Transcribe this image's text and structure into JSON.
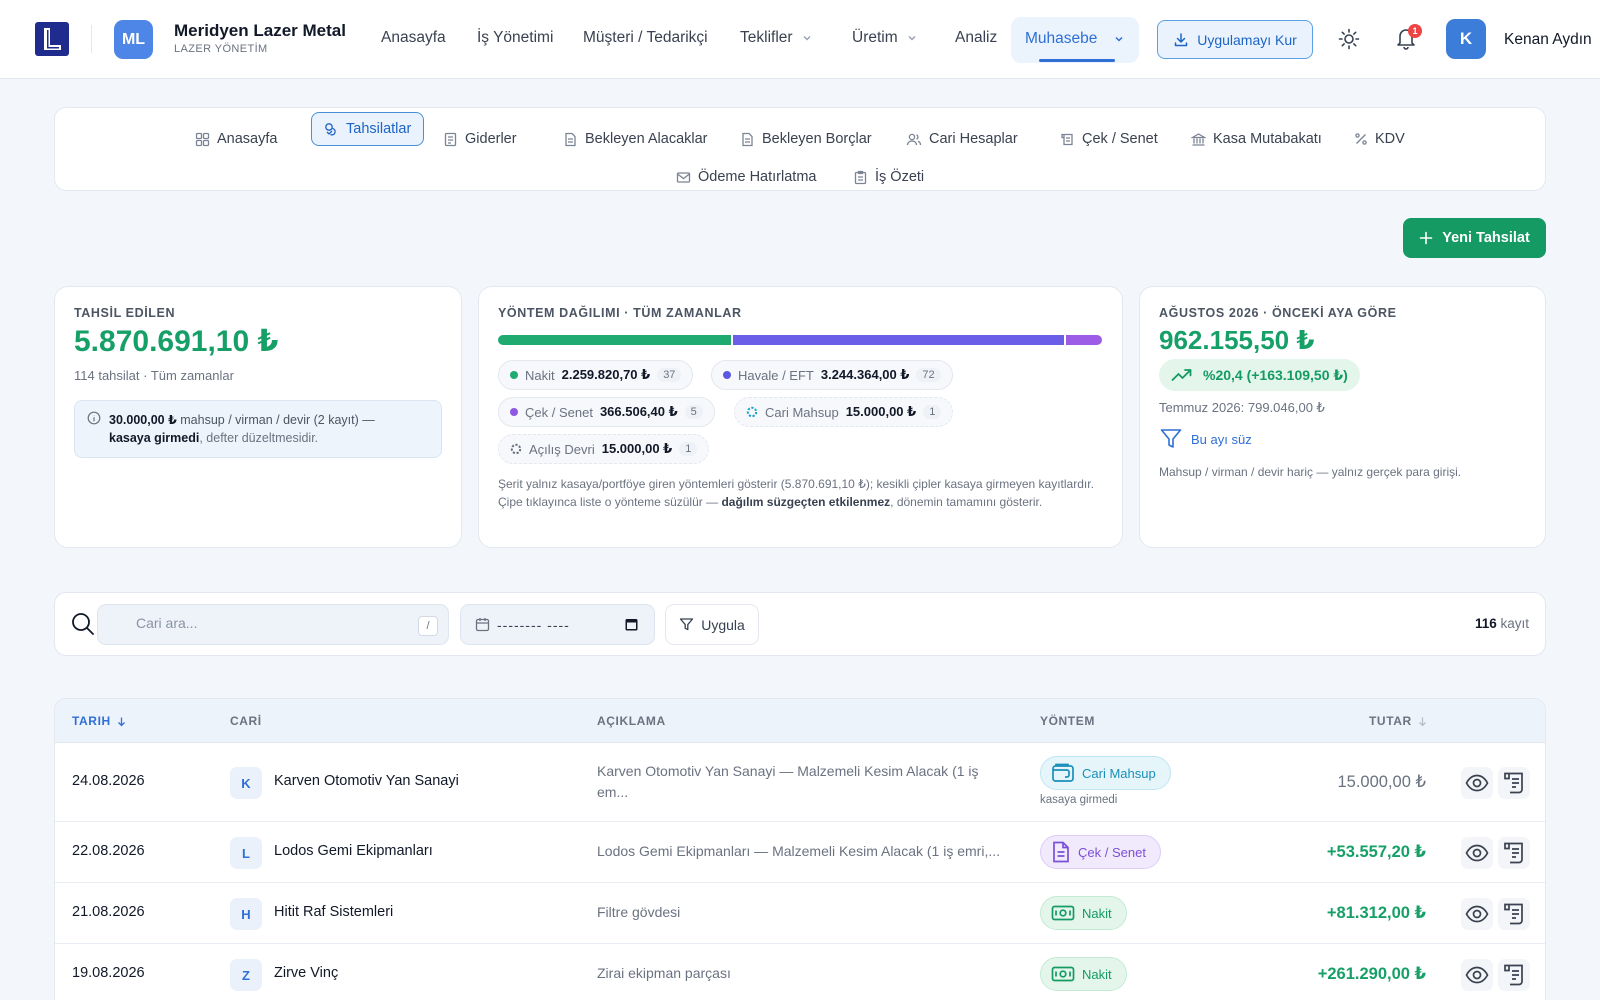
{
  "header": {
    "logo_letter": "L",
    "company": {
      "avatar": "ML",
      "name": "Meridyen Lazer Metal",
      "subtitle": "LAZER YÖNETİM"
    },
    "nav": [
      "Anasayfa",
      "İş Yönetimi",
      "Müşteri / Tedarikçi",
      "Teklifler",
      "Üretim",
      "Analiz",
      "Muhasebe"
    ],
    "active_nav": "Muhasebe",
    "install_label": "Uygulamayı Kur",
    "notification_count": "1",
    "user": {
      "avatar": "K",
      "name": "Kenan Aydın"
    }
  },
  "subnav": {
    "items": [
      "Anasayfa",
      "Tahsilatlar",
      "Giderler",
      "Bekleyen Alacaklar",
      "Bekleyen Borçlar",
      "Cari Hesaplar",
      "Çek / Senet",
      "Kasa Mutabakatı",
      "KDV",
      "Ödeme Hatırlatma",
      "İş Özeti"
    ],
    "active": "Tahsilatlar"
  },
  "new_button_label": "Yeni Tahsilat",
  "collected": {
    "label": "TAHSİL EDİLEN",
    "amount": "5.870.691,10 ₺",
    "sub": "114 tahsilat · Tüm zamanlar",
    "note_amount": "30.000,00 ₺",
    "note_text1": " mahsup / virman / devir (2 kayıt) —",
    "note_bold": "kasaya girmedi",
    "note_text2": ", defter düzeltmesidir."
  },
  "method_dist": {
    "label": "YÖNTEM DAĞILIMI · TÜM ZAMANLAR",
    "bar": [
      {
        "name": "Nakit",
        "fraction": 0.385,
        "color": "#1faa72"
      },
      {
        "name": "Havale / EFT",
        "fraction": 0.552,
        "color": "#6a5ee8"
      },
      {
        "name": "Çek / Senet",
        "fraction": 0.063,
        "color": "#9c5ce6"
      }
    ],
    "chips": [
      {
        "name": "Nakit",
        "value": "2.259.820,70 ₺",
        "count": "37",
        "color": "#1faa72"
      },
      {
        "name": "Havale / EFT",
        "value": "3.244.364,00 ₺",
        "count": "72",
        "color": "#5b57e0"
      },
      {
        "name": "Çek / Senet",
        "value": "366.506,40 ₺",
        "count": "5",
        "color": "#8e58e0"
      },
      {
        "name": "Cari Mahsup",
        "value": "15.000,00 ₺",
        "count": "1",
        "color": "#1aa3c8"
      },
      {
        "name": "Açılış Devri",
        "value": "15.000,00 ₺",
        "count": "1",
        "color": "#6b7280"
      }
    ],
    "foot_text1": "Şerit yalnız kasaya/portföye giren yöntemleri gösterir (5.870.691,10 ₺); kesikli çipler kasaya girmeyen kayıtlardır. Çipe tıklayınca liste o yönteme süzülür — ",
    "foot_bold": "dağılım süzgeçten etkilenmez",
    "foot_text2": ", dönemin tamamını gösterir."
  },
  "month_compare": {
    "label": "AĞUSTOS 2026 · ÖNCEKİ AYA GÖRE",
    "amount": "962.155,50 ₺",
    "change": "%20,4 (+163.109,50 ₺)",
    "prev": "Temmuz 2026: 799.046,00 ₺",
    "filter_label": "Bu ayı süz",
    "foot": "Mahsup / virman / devir hariç — yalnız gerçek para girişi."
  },
  "filters": {
    "search_placeholder": "Cari ara...",
    "shortcut": "/",
    "date_mask": "-------- ----",
    "apply_label": "Uygula",
    "count": "116",
    "count_suffix": " kayıt"
  },
  "table": {
    "headers": {
      "date": "TARIH",
      "cari": "CARİ",
      "desc": "AÇIKLAMA",
      "method": "YÖNTEM",
      "amount": "TUTAR"
    },
    "rows": [
      {
        "date": "24.08.2026",
        "initial": "K",
        "cari": "Karven Otomotiv Yan Sanayi",
        "desc": "Karven Otomotiv Yan Sanayi — Malzemeli Kesim Alacak (1 iş em...",
        "method": "Cari Mahsup",
        "method_note": "kasaya girmedi",
        "amount": "15.000,00 ₺"
      },
      {
        "date": "22.08.2026",
        "initial": "L",
        "cari": "Lodos Gemi Ekipmanları",
        "desc": "Lodos Gemi Ekipmanları — Malzemeli Kesim Alacak (1 iş emri,...",
        "method": "Çek / Senet",
        "method_note": "",
        "amount": "+53.557,20 ₺"
      },
      {
        "date": "21.08.2026",
        "initial": "H",
        "cari": "Hitit Raf Sistemleri",
        "desc": "Filtre gövdesi",
        "method": "Nakit",
        "method_note": "",
        "amount": "+81.312,00 ₺"
      },
      {
        "date": "19.08.2026",
        "initial": "Z",
        "cari": "Zirve Vinç",
        "desc": "Zirai ekipman parçası",
        "method": "Nakit",
        "method_note": "",
        "amount": "+261.290,00 ₺"
      }
    ]
  }
}
